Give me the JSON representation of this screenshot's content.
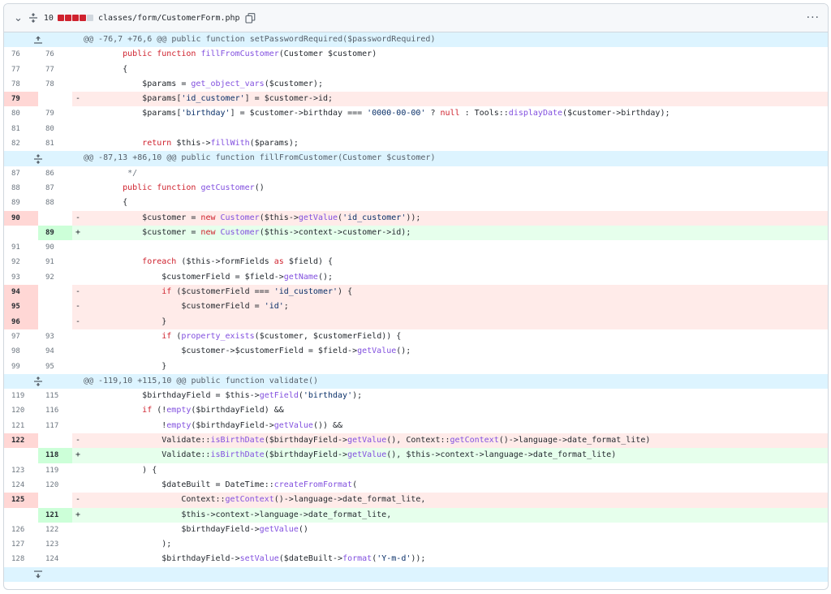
{
  "file": {
    "changes_count": "10",
    "path": "classes/form/CustomerForm.php",
    "menu_label": "···"
  },
  "diff": [
    {
      "type": "hunk",
      "dir": "up",
      "text": "@@ -76,7 +76,6 @@ public function setPasswordRequired($passwordRequired)"
    },
    {
      "type": "ctx",
      "old": "76",
      "new": "76",
      "code": "    public function fillFromCustomer(Customer $customer)"
    },
    {
      "type": "ctx",
      "old": "77",
      "new": "77",
      "code": "    {"
    },
    {
      "type": "ctx",
      "old": "78",
      "new": "78",
      "code": "        $params = get_object_vars($customer);"
    },
    {
      "type": "del",
      "old": "79",
      "new": "",
      "code": "        $params['id_customer'] = $customer->id;"
    },
    {
      "type": "ctx",
      "old": "80",
      "new": "79",
      "code": "        $params['birthday'] = $customer->birthday === '0000-00-00' ? null : Tools::displayDate($customer->birthday);"
    },
    {
      "type": "ctx",
      "old": "81",
      "new": "80",
      "code": ""
    },
    {
      "type": "ctx",
      "old": "82",
      "new": "81",
      "code": "        return $this->fillWith($params);"
    },
    {
      "type": "hunk",
      "dir": "both",
      "text": "@@ -87,13 +86,10 @@ public function fillFromCustomer(Customer $customer)"
    },
    {
      "type": "ctx",
      "old": "87",
      "new": "86",
      "code": "     */"
    },
    {
      "type": "ctx",
      "old": "88",
      "new": "87",
      "code": "    public function getCustomer()"
    },
    {
      "type": "ctx",
      "old": "89",
      "new": "88",
      "code": "    {"
    },
    {
      "type": "del",
      "old": "90",
      "new": "",
      "code": "        $customer = new Customer($this->getValue('id_customer'));"
    },
    {
      "type": "add",
      "old": "",
      "new": "89",
      "code": "        $customer = new Customer($this->context->customer->id);"
    },
    {
      "type": "ctx",
      "old": "91",
      "new": "90",
      "code": ""
    },
    {
      "type": "ctx",
      "old": "92",
      "new": "91",
      "code": "        foreach ($this->formFields as $field) {"
    },
    {
      "type": "ctx",
      "old": "93",
      "new": "92",
      "code": "            $customerField = $field->getName();"
    },
    {
      "type": "del",
      "old": "94",
      "new": "",
      "code": "            if ($customerField === 'id_customer') {"
    },
    {
      "type": "del",
      "old": "95",
      "new": "",
      "code": "                $customerField = 'id';"
    },
    {
      "type": "del",
      "old": "96",
      "new": "",
      "code": "            }"
    },
    {
      "type": "ctx",
      "old": "97",
      "new": "93",
      "code": "            if (property_exists($customer, $customerField)) {"
    },
    {
      "type": "ctx",
      "old": "98",
      "new": "94",
      "code": "                $customer->$customerField = $field->getValue();"
    },
    {
      "type": "ctx",
      "old": "99",
      "new": "95",
      "code": "            }"
    },
    {
      "type": "hunk",
      "dir": "both",
      "text": "@@ -119,10 +115,10 @@ public function validate()"
    },
    {
      "type": "ctx",
      "old": "119",
      "new": "115",
      "code": "        $birthdayField = $this->getField('birthday');"
    },
    {
      "type": "ctx",
      "old": "120",
      "new": "116",
      "code": "        if (!empty($birthdayField) &&"
    },
    {
      "type": "ctx",
      "old": "121",
      "new": "117",
      "code": "            !empty($birthdayField->getValue()) &&"
    },
    {
      "type": "del",
      "old": "122",
      "new": "",
      "code": "            Validate::isBirthDate($birthdayField->getValue(), Context::getContext()->language->date_format_lite)"
    },
    {
      "type": "add",
      "old": "",
      "new": "118",
      "code": "            Validate::isBirthDate($birthdayField->getValue(), $this->context->language->date_format_lite)"
    },
    {
      "type": "ctx",
      "old": "123",
      "new": "119",
      "code": "        ) {"
    },
    {
      "type": "ctx",
      "old": "124",
      "new": "120",
      "code": "            $dateBuilt = DateTime::createFromFormat("
    },
    {
      "type": "del",
      "old": "125",
      "new": "",
      "code": "                Context::getContext()->language->date_format_lite,"
    },
    {
      "type": "add",
      "old": "",
      "new": "121",
      "code": "                $this->context->language->date_format_lite,"
    },
    {
      "type": "ctx",
      "old": "126",
      "new": "122",
      "code": "                $birthdayField->getValue()"
    },
    {
      "type": "ctx",
      "old": "127",
      "new": "123",
      "code": "            );"
    },
    {
      "type": "ctx",
      "old": "128",
      "new": "124",
      "code": "            $birthdayField->setValue($dateBuilt->format('Y-m-d'));"
    },
    {
      "type": "hunk",
      "dir": "down",
      "text": ""
    }
  ]
}
